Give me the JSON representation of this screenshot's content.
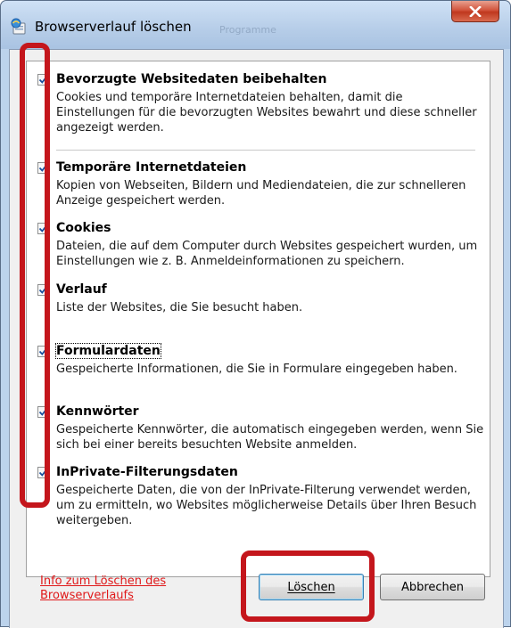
{
  "window": {
    "title": "Browserverlauf löschen",
    "ghost_tab": "Programme",
    "close_glyph": "x"
  },
  "options": [
    {
      "label": "Bevorzugte Websitedaten beibehalten",
      "description": "Cookies und temporäre Internetdateien behalten, damit die Einstellungen für die bevorzugten Websites bewahrt und diese schneller angezeigt werden.",
      "checked": true
    },
    {
      "label": "Temporäre Internetdateien",
      "description": "Kopien von Webseiten, Bildern und Mediendateien, die zur schnelleren Anzeige gespeichert werden.",
      "checked": true
    },
    {
      "label": "Cookies",
      "description": "Dateien, die auf dem Computer durch Websites gespeichert wurden, um Einstellungen wie z. B. Anmeldeinformationen zu speichern.",
      "checked": true
    },
    {
      "label": "Verlauf",
      "description": "Liste der Websites, die Sie besucht haben.",
      "checked": true
    },
    {
      "label": "Formulardaten",
      "description": "Gespeicherte Informationen, die Sie in Formulare eingegeben haben.",
      "checked": true
    },
    {
      "label": "Kennwörter",
      "description": "Gespeicherte Kennwörter, die automatisch eingegeben werden, wenn Sie sich bei einer bereits besuchten Website anmelden.",
      "checked": true
    },
    {
      "label": "InPrivate-Filterungsdaten",
      "description": "Gespeicherte Daten, die von der InPrivate-Filterung verwendet werden, um zu ermitteln, wo Websites möglicherweise Details über Ihren Besuch weitergeben.",
      "checked": true
    }
  ],
  "footer": {
    "info_link": "Info zum Löschen des Browserverlaufs",
    "delete_button": "Löschen",
    "cancel_button": "Abbrechen"
  },
  "colors": {
    "annotation": "#c4161c",
    "link": "#e0191a",
    "check": "#1b4f9c"
  },
  "icons": {
    "title": "browser-history-icon",
    "checkmark": "checkmark-icon"
  }
}
